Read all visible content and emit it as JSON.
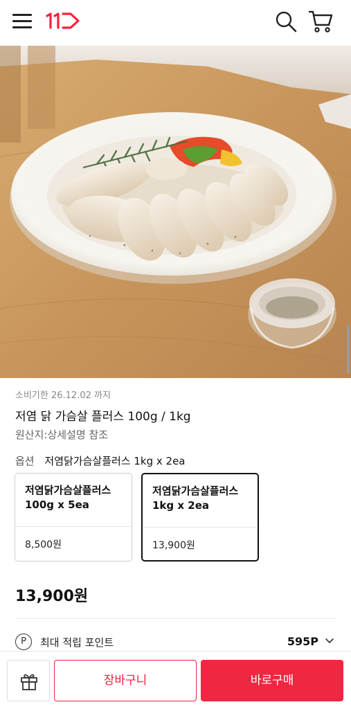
{
  "header": {
    "logo_text": "11",
    "brand_color": "#ff1e3c"
  },
  "product": {
    "expiry": "소비기한 26.12.02 까지",
    "name": "저염 닭 가슴살 플러스 100g / 1kg",
    "origin": "원산지:상세설명 참조"
  },
  "option": {
    "label": "옵션",
    "selected_value": "저염닭가슴살플러스 1kg x 2ea",
    "cards": [
      {
        "title": "저염닭가슴살플러스 100g x 5ea",
        "price": "8,500원",
        "selected": false
      },
      {
        "title": "저염닭가슴살플러스 1kg x 2ea",
        "price": "13,900원",
        "selected": true
      }
    ]
  },
  "price": "13,900원",
  "points": {
    "icon_letter": "P",
    "label": "최대 적립 포인트",
    "value": "595P"
  },
  "bottom": {
    "cart_label": "장바구니",
    "buy_label": "바로구매",
    "accent_color": "#ef2742"
  }
}
